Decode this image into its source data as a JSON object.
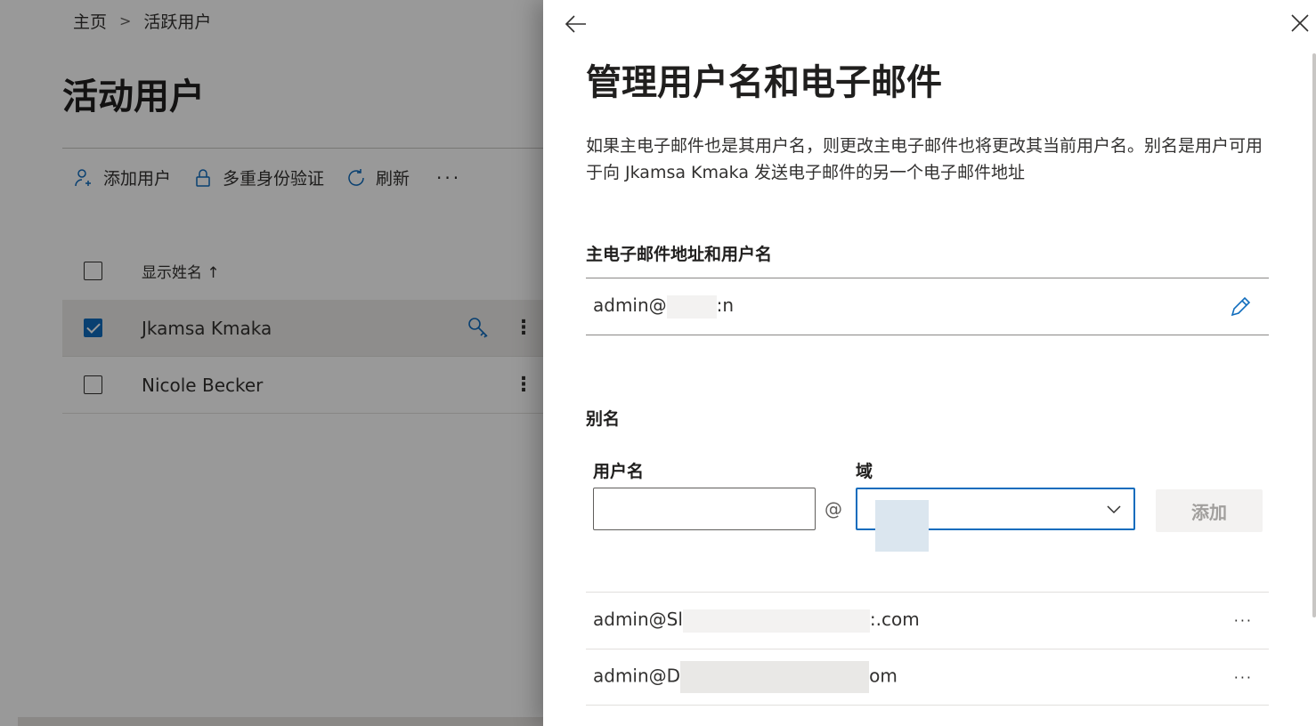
{
  "breadcrumb": {
    "home": "主页",
    "current": "活跃用户"
  },
  "page_title": "活动用户",
  "commands": {
    "add_user": "添加用户",
    "mfa": "多重身份验证",
    "refresh": "刷新",
    "more": "···"
  },
  "list": {
    "header": "显示姓名 ↑",
    "rows": [
      {
        "name": "Jkamsa Kmaka",
        "selected": true
      },
      {
        "name": "Nicole Becker",
        "selected": false
      }
    ]
  },
  "panel": {
    "title": "管理用户名和电子邮件",
    "description": "如果主电子邮件也是其用户名，则更改主电子邮件也将更改其当前用户名。别名是用户可用于向 Jkamsa Kmaka 发送电子邮件的另一个电子邮件地址",
    "primary_heading": "主电子邮件地址和用户名",
    "primary_email_start": "admin@",
    "primary_email_end": ":n",
    "alias_heading": "别名",
    "username_label": "用户名",
    "username_value": "",
    "domain_label": "域",
    "at_symbol": "@",
    "add_button": "添加",
    "aliases": [
      {
        "start": "admin@Sl",
        "end": ":.com",
        "more": "···"
      },
      {
        "start": "admin@D",
        "end": "om",
        "more": "···"
      }
    ]
  },
  "colors": {
    "accent": "#0f6cbd",
    "overlay": "rgba(0,0,0,0.4)"
  }
}
